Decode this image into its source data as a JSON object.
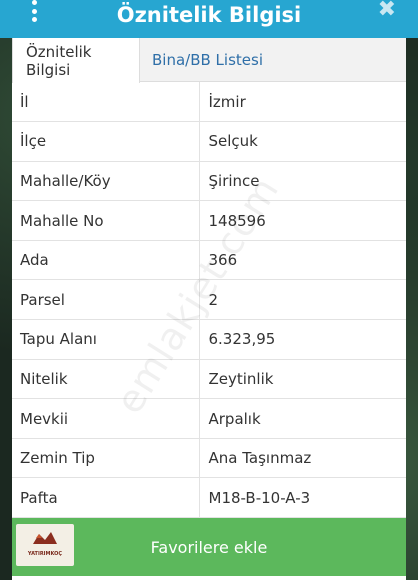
{
  "header": {
    "title": "Öznitelik Bilgisi",
    "close_label": "✖"
  },
  "tabs": [
    {
      "label": "Öznitelik Bilgisi",
      "active": true
    },
    {
      "label": "Bina/BB Listesi",
      "active": false
    }
  ],
  "rows": [
    {
      "key": "İl",
      "value": "İzmir"
    },
    {
      "key": "İlçe",
      "value": "Selçuk"
    },
    {
      "key": "Mahalle/Köy",
      "value": "Şirince"
    },
    {
      "key": "Mahalle No",
      "value": "148596"
    },
    {
      "key": "Ada",
      "value": "366"
    },
    {
      "key": "Parsel",
      "value": "2"
    },
    {
      "key": "Tapu Alanı",
      "value": "6.323,95"
    },
    {
      "key": "Nitelik",
      "value": "Zeytinlik"
    },
    {
      "key": "Mevkii",
      "value": "Arpalık"
    },
    {
      "key": "Zemin Tip",
      "value": "Ana Taşınmaz"
    },
    {
      "key": "Pafta",
      "value": "M18-B-10-A-3"
    }
  ],
  "watermark": "emlakjet.com",
  "footer": {
    "button_label": "Favorilere ekle",
    "logo_text": "YATIRIMKOÇ"
  },
  "colors": {
    "header": "#27a6d1",
    "button": "#5cb85c",
    "tab_link": "#2f6fa8"
  }
}
